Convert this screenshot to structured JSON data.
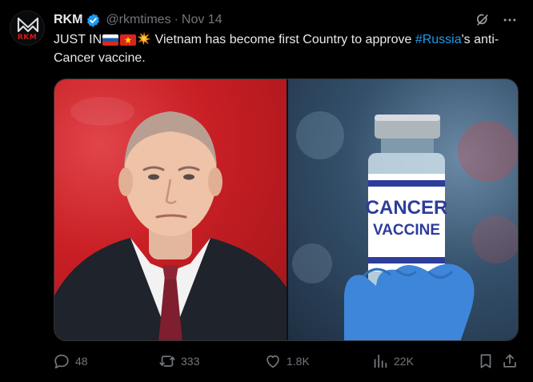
{
  "author": {
    "avatar_text": "RKM",
    "display_name": "RKM",
    "handle": "@rkmtimes",
    "separator": "·",
    "date": "Nov 14"
  },
  "tweet": {
    "text_prefix": "JUST IN",
    "text_main": " Vietnam has become first Country to approve ",
    "hashtag": "#Russia",
    "text_suffix": "'s anti-Cancer vaccine."
  },
  "media": {
    "vaccine_label_line1": "CANCER",
    "vaccine_label_line2": "VACCINE"
  },
  "actions": {
    "replies": "48",
    "reposts": "333",
    "likes": "1.8K",
    "views": "22K"
  },
  "colors": {
    "accent": "#1d9bf0",
    "muted": "#71767b",
    "text": "#e7e9ea",
    "background": "#000000"
  },
  "icons": [
    "verified-badge-icon",
    "grok-icon",
    "more-icon",
    "reply-icon",
    "repost-icon",
    "like-icon",
    "views-icon",
    "bookmark-icon",
    "share-icon"
  ]
}
